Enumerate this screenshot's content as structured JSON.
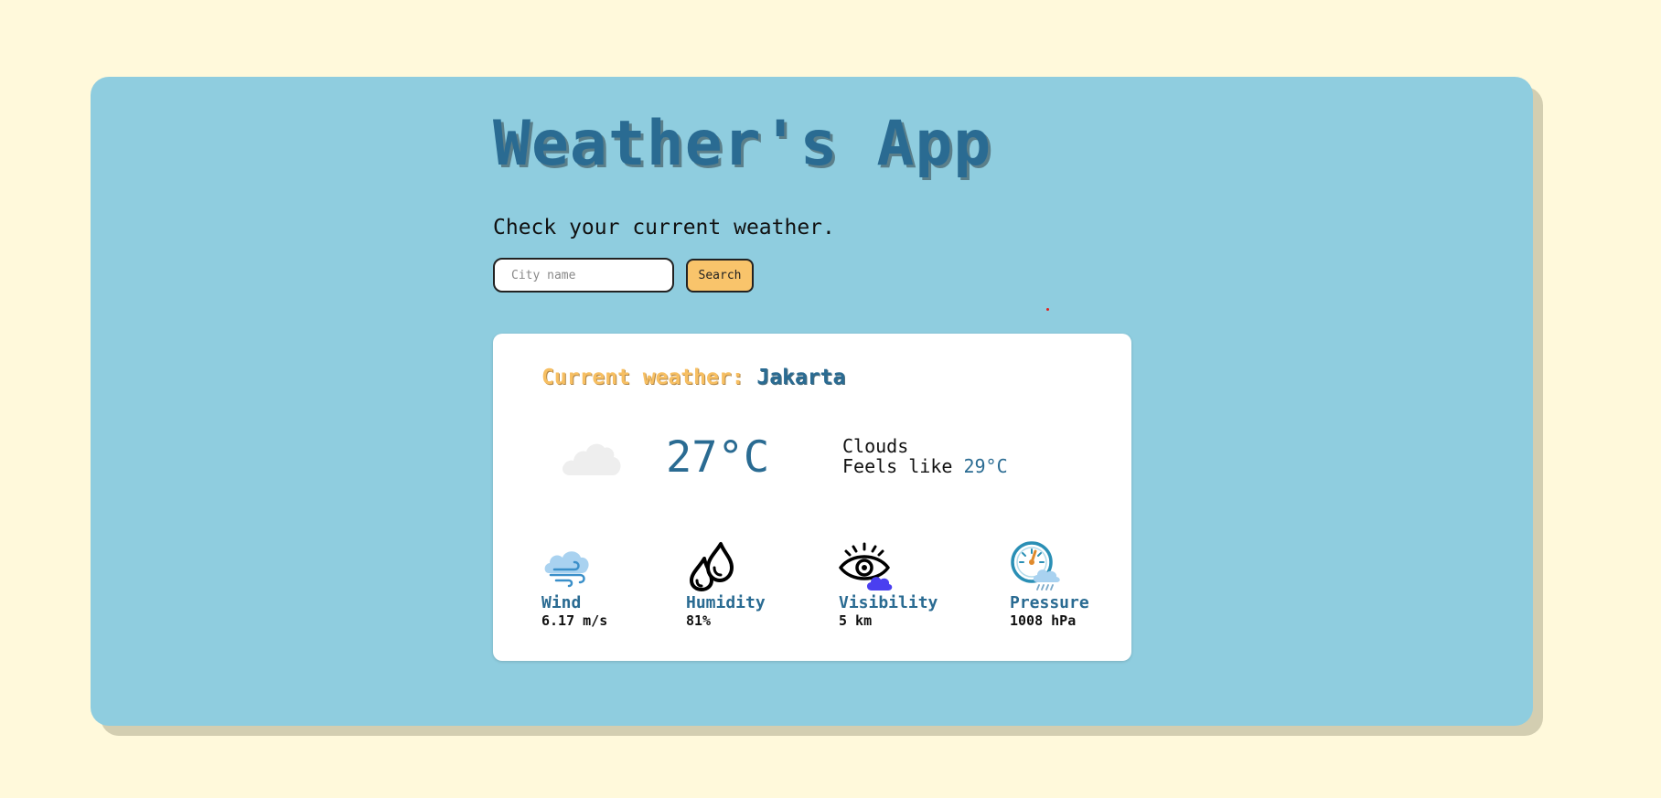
{
  "app": {
    "title": "Weather's App",
    "subtitle": "Check your current weather."
  },
  "search": {
    "placeholder": "City name",
    "value": "",
    "button_label": "Search"
  },
  "current": {
    "label": "Current weather:",
    "city": "Jakarta",
    "condition_icon": "cloud-icon",
    "temperature": "27°C",
    "condition": "Clouds",
    "feels_like_label": "Feels like",
    "feels_like_value": "29°C"
  },
  "stats": [
    {
      "label": "Wind",
      "value": "6.17 m/s",
      "icon": "wind-icon"
    },
    {
      "label": "Humidity",
      "value": "81%",
      "icon": "humidity-icon"
    },
    {
      "label": "Visibility",
      "value": "5 km",
      "icon": "visibility-icon"
    },
    {
      "label": "Pressure",
      "value": "1008 hPa",
      "icon": "pressure-icon"
    }
  ],
  "colors": {
    "page_background": "#fff9db",
    "panel_background": "#8fcddf",
    "accent_blue": "#2a6b92",
    "accent_yellow": "#f7bf62",
    "button_yellow": "#f9c46b"
  }
}
